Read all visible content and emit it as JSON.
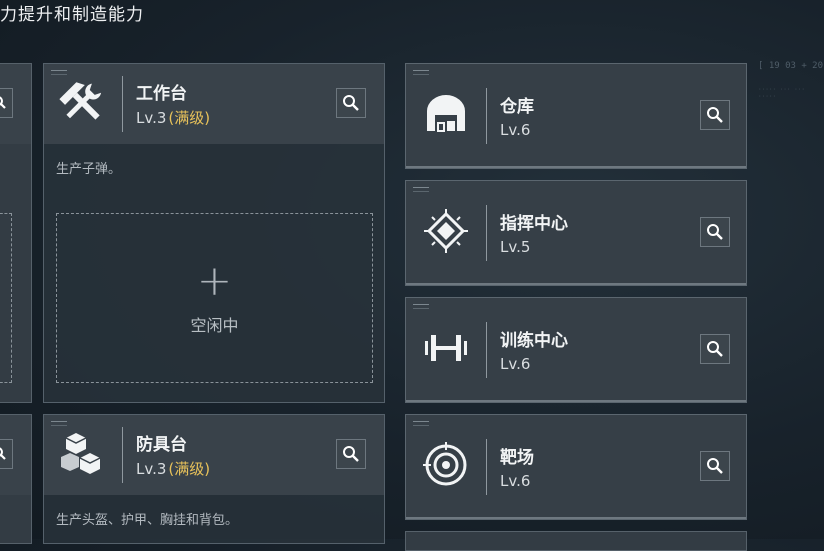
{
  "header": {
    "title": "力提升和制造能力"
  },
  "hud": {
    "line1": "[ 19 03 + 20",
    "line2": "····· ··· ··· ·····"
  },
  "workbench": {
    "name": "工作台",
    "level": "Lv.3",
    "max_label": "(满级)",
    "description": "生产子弹。",
    "slot_icon": "+",
    "slot_label": "空闲中"
  },
  "armor_bench": {
    "name": "防具台",
    "level": "Lv.3",
    "max_label": "(满级)",
    "description": "生产头盔、护甲、胸挂和背包。"
  },
  "facilities": [
    {
      "name": "仓库",
      "level": "Lv.6",
      "icon": "warehouse-icon"
    },
    {
      "name": "指挥中心",
      "level": "Lv.5",
      "icon": "command-center-icon"
    },
    {
      "name": "训练中心",
      "level": "Lv.6",
      "icon": "dumbbell-icon"
    },
    {
      "name": "靶场",
      "level": "Lv.6",
      "icon": "target-icon"
    }
  ],
  "colors": {
    "max_level": "#e7c15a",
    "background": "#18222b",
    "card": "#39424a"
  }
}
